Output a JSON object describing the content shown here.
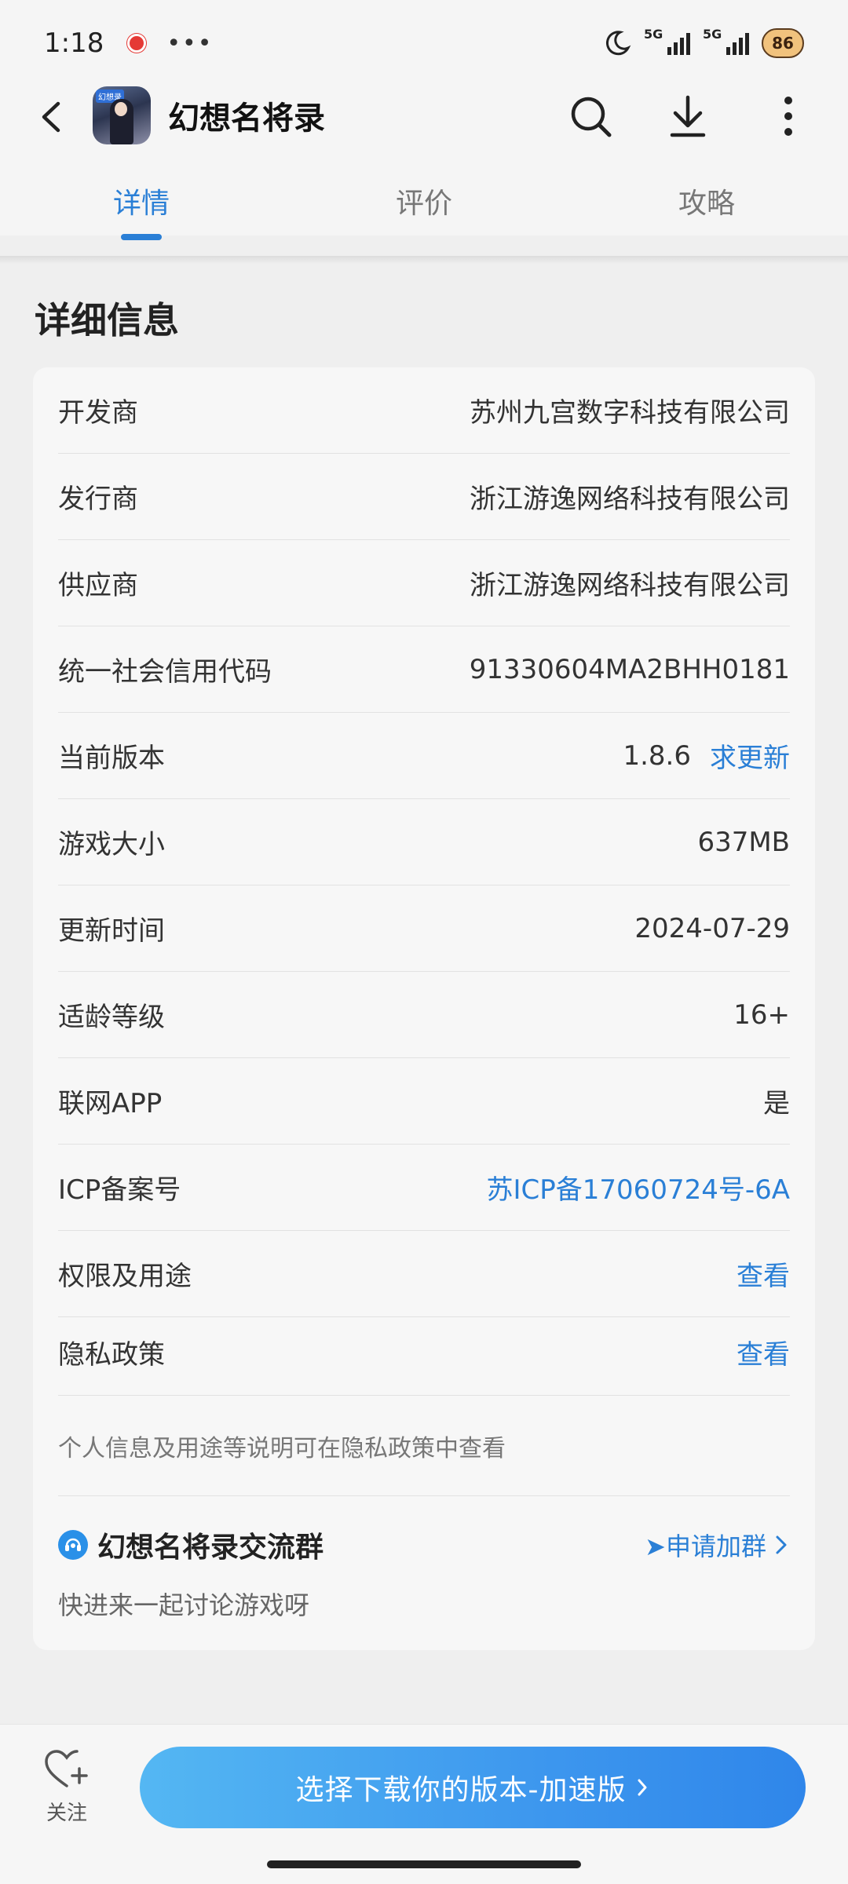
{
  "status": {
    "time": "1:18",
    "dots": "•••",
    "net1": "5G",
    "net2": "5G",
    "battery": "86"
  },
  "header": {
    "title": "幻想名将录",
    "logo_tag": "幻想录"
  },
  "tabs": [
    {
      "label": "详情"
    },
    {
      "label": "评价"
    },
    {
      "label": "攻略"
    }
  ],
  "section": {
    "title": "详细信息"
  },
  "details": [
    {
      "label": "开发商",
      "value": "苏州九宫数字科技有限公司"
    },
    {
      "label": "发行商",
      "value": "浙江游逸网络科技有限公司"
    },
    {
      "label": "供应商",
      "value": "浙江游逸网络科技有限公司"
    },
    {
      "label": "统一社会信用代码",
      "value": "91330604MA2BHH0181"
    },
    {
      "label": "当前版本",
      "value": "1.8.6",
      "action": "求更新"
    },
    {
      "label": "游戏大小",
      "value": "637MB"
    },
    {
      "label": "更新时间",
      "value": "2024-07-29"
    },
    {
      "label": "适龄等级",
      "value": "16+"
    },
    {
      "label": "联网APP",
      "value": "是"
    },
    {
      "label": "ICP备案号",
      "value": "苏ICP备17060724号-6A"
    },
    {
      "label": "权限及用途",
      "value": "查看"
    },
    {
      "label": "隐私政策",
      "value": "查看"
    }
  ],
  "privacy_note": "个人信息及用途等说明可在隐私政策中查看",
  "group": {
    "title": "幻想名将录交流群",
    "join": "➤申请加群",
    "subtitle": "快进来一起讨论游戏呀"
  },
  "bottom": {
    "follow": "关注",
    "cta": "选择下载你的版本-加速版"
  },
  "colors": {
    "accent": "#2a7fd6",
    "cta_start": "#54b7f3",
    "cta_end": "#2f86ea"
  }
}
